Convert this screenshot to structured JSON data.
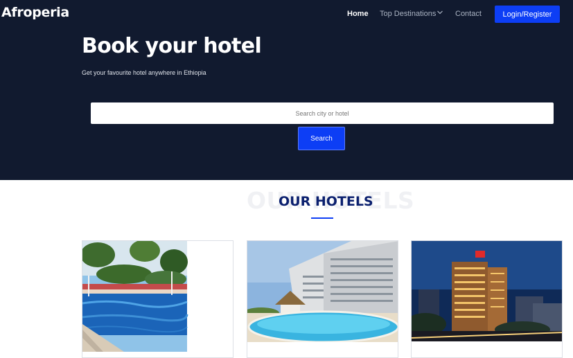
{
  "brand": {
    "name": "Afroperia"
  },
  "nav": {
    "home": "Home",
    "top_destinations": "Top Destinations",
    "contact": "Contact",
    "login": "Login/Register"
  },
  "hero": {
    "title": "Book your hotel",
    "subtitle": "Get your favourite hotel anywhere in Ethiopia"
  },
  "search": {
    "placeholder": "Search city or hotel",
    "button": "Search"
  },
  "section": {
    "background_text": "OUR HOTELS",
    "title": "OUR HOTELS"
  },
  "colors": {
    "hero_bg": "#111a2f",
    "accent": "#0d3ef5",
    "section_title": "#0a1f6e"
  }
}
